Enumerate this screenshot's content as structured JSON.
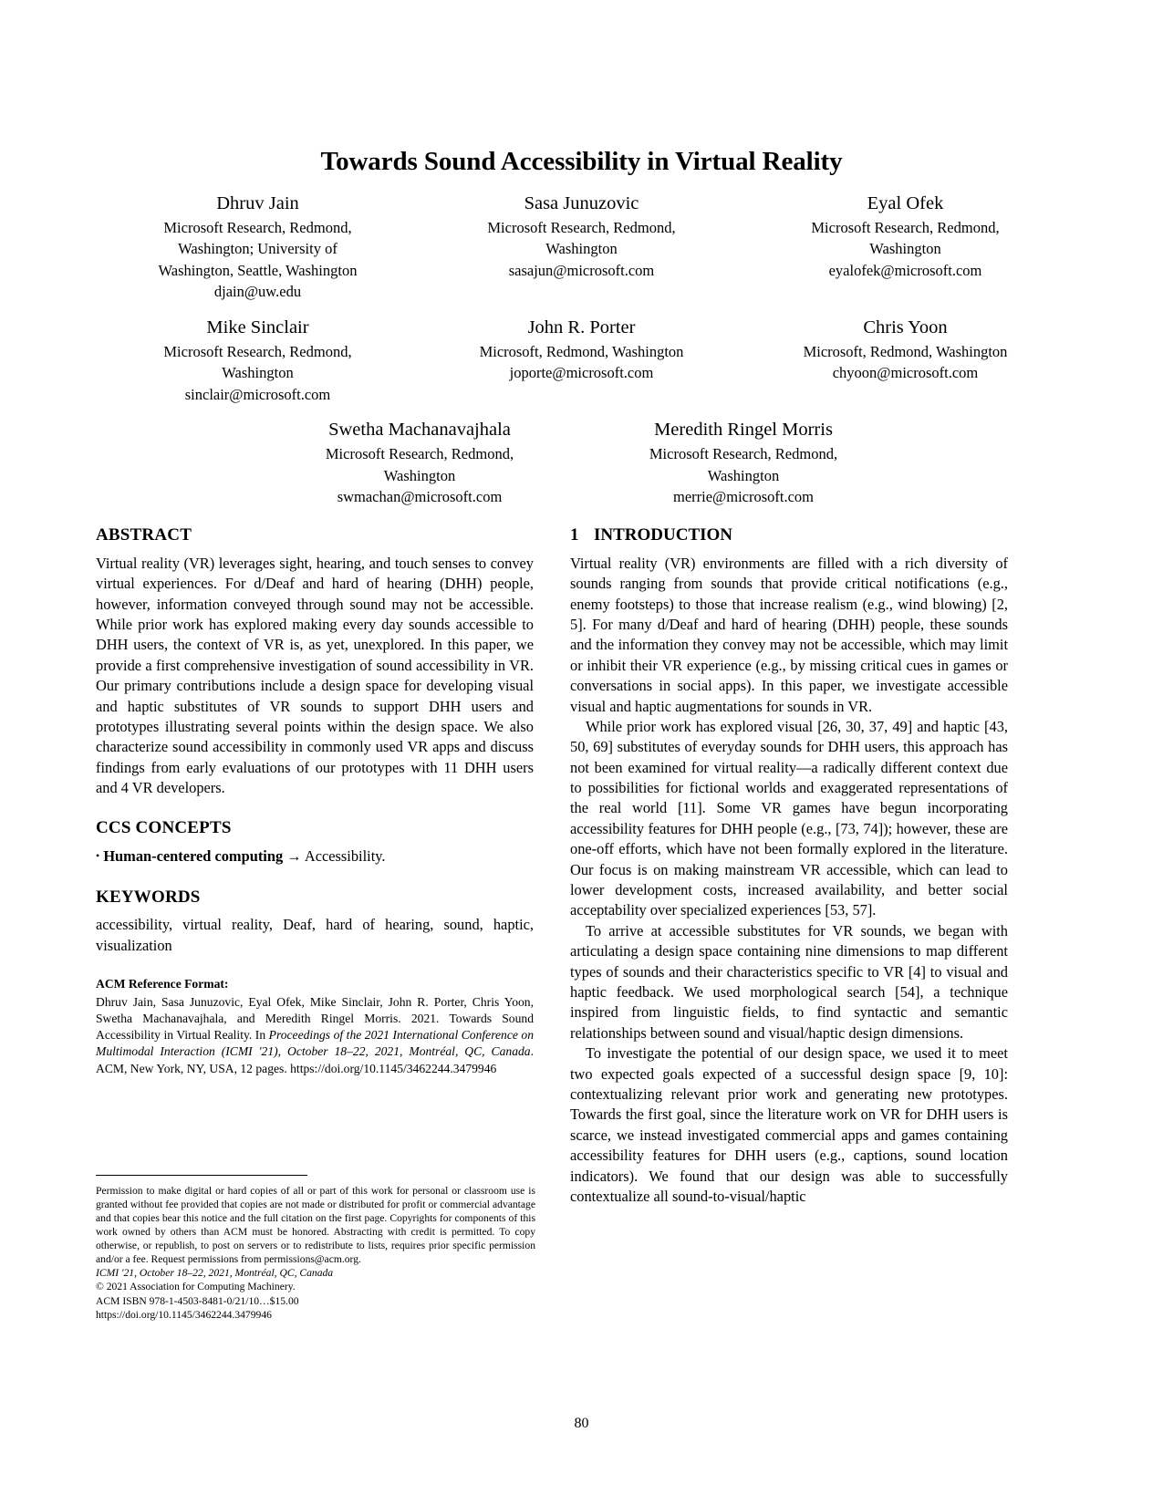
{
  "paper": {
    "title": "Towards Sound Accessibility in Virtual Reality",
    "page_number": "80",
    "authors": [
      {
        "name": "Dhruv Jain",
        "affiliation_lines": [
          "Microsoft Research, Redmond,",
          "Washington; University of",
          "Washington, Seattle, Washington"
        ],
        "email": "djain@uw.edu"
      },
      {
        "name": "Sasa Junuzovic",
        "affiliation_lines": [
          "Microsoft Research, Redmond,",
          "Washington"
        ],
        "email": "sasajun@microsoft.com"
      },
      {
        "name": "Eyal Ofek",
        "affiliation_lines": [
          "Microsoft Research, Redmond,",
          "Washington"
        ],
        "email": "eyalofek@microsoft.com"
      },
      {
        "name": "Mike Sinclair",
        "affiliation_lines": [
          "Microsoft Research, Redmond,",
          "Washington"
        ],
        "email": "sinclair@microsoft.com"
      },
      {
        "name": "John R. Porter",
        "affiliation_lines": [
          "Microsoft, Redmond, Washington"
        ],
        "email": "joporte@microsoft.com"
      },
      {
        "name": "Chris Yoon",
        "affiliation_lines": [
          "Microsoft, Redmond, Washington"
        ],
        "email": "chyoon@microsoft.com"
      },
      {
        "name": "Swetha Machanavajhala",
        "affiliation_lines": [
          "Microsoft Research, Redmond,",
          "Washington"
        ],
        "email": "swmachan@microsoft.com"
      },
      {
        "name": "Meredith Ringel Morris",
        "affiliation_lines": [
          "Microsoft Research, Redmond,",
          "Washington"
        ],
        "email": "merrie@microsoft.com"
      }
    ],
    "abstract": {
      "heading": "ABSTRACT",
      "text": "Virtual reality (VR) leverages sight, hearing, and touch senses to convey virtual experiences. For d/Deaf and hard of hearing (DHH) people, however, information conveyed through sound may not be accessible. While prior work has explored making every day sounds accessible to DHH users, the context of VR is, as yet, unexplored. In this paper, we provide a first comprehensive investigation of sound accessibility in VR. Our primary contributions include a design space for developing visual and haptic substitutes of VR sounds to support DHH users and prototypes illustrating several points within the design space. We also characterize sound accessibility in commonly used VR apps and discuss findings from early evaluations of our prototypes with 11 DHH users and 4 VR developers."
    },
    "ccs": {
      "heading": "CCS CONCEPTS",
      "bullet": "•",
      "bold_part": "Human-centered computing",
      "arrow": "→",
      "rest": "Accessibility."
    },
    "keywords": {
      "heading": "KEYWORDS",
      "text": "accessibility, virtual reality, Deaf, hard of hearing, sound, haptic, visualization"
    },
    "reference_format": {
      "label": "ACM Reference Format:",
      "part1": "Dhruv Jain, Sasa Junuzovic, Eyal Ofek, Mike Sinclair, John R. Porter, Chris Yoon, Swetha Machanavajhala, and Meredith Ringel Morris. 2021. Towards Sound Accessibility in Virtual Reality. In ",
      "italic1": "Proceedings of the 2021 International Conference on Multimodal Interaction (ICMI '21), October 18–22, 2021, Montréal, QC, Canada",
      "part2": ". ACM, New York, NY, USA, 12 pages. ",
      "doi": "https://doi.org/10.1145/3462244.3479946"
    },
    "permission": {
      "paragraph": "Permission to make digital or hard copies of all or part of this work for personal or classroom use is granted without fee provided that copies are not made or distributed for profit or commercial advantage and that copies bear this notice and the full citation on the first page. Copyrights for components of this work owned by others than ACM must be honored. Abstracting with credit is permitted. To copy otherwise, or republish, to post on servers or to redistribute to lists, requires prior specific permission and/or a fee. Request permissions from permissions@acm.org.",
      "conference": "ICMI '21, October 18–22, 2021, Montréal, QC, Canada",
      "copyright": "© 2021 Association for Computing Machinery.",
      "isbn": "ACM ISBN 978-1-4503-8481-0/21/10…$15.00",
      "doi": "https://doi.org/10.1145/3462244.3479946"
    },
    "introduction": {
      "number": "1",
      "heading": "INTRODUCTION",
      "paragraphs": [
        "Virtual reality (VR) environments are filled with a rich diversity of sounds ranging from sounds that provide critical notifications (e.g., enemy footsteps) to those that increase realism (e.g., wind blowing) [2, 5]. For many d/Deaf and hard of hearing (DHH) people, these sounds and the information they convey may not be accessible, which may limit or inhibit their VR experience (e.g., by missing critical cues in games or conversations in social apps). In this paper, we investigate accessible visual and haptic augmentations for sounds in VR.",
        "While prior work has explored visual [26, 30, 37, 49] and haptic [43, 50, 69] substitutes of everyday sounds for DHH users, this approach has not been examined for virtual reality—a radically different context due to possibilities for fictional worlds and exaggerated representations of the real world [11]. Some VR games have begun incorporating accessibility features for DHH people (e.g., [73, 74]); however, these are one-off efforts, which have not been formally explored in the literature. Our focus is on making mainstream VR accessible, which can lead to lower development costs, increased availability, and better social acceptability over specialized experiences [53, 57].",
        "To arrive at accessible substitutes for VR sounds, we began with articulating a design space containing nine dimensions to map different types of sounds and their characteristics specific to VR [4] to visual and haptic feedback. We used morphological search [54], a technique inspired from linguistic fields, to find syntactic and semantic relationships between sound and visual/haptic design dimensions.",
        "To investigate the potential of our design space, we used it to meet two expected goals expected of a successful design space [9, 10]: contextualizing relevant prior work and generating new prototypes. Towards the first goal, since the literature work on VR for DHH users is scarce, we instead investigated commercial apps and games containing accessibility features for DHH users (e.g., captions, sound location indicators). We found that our design was able to successfully contextualize all sound-to-visual/haptic"
      ]
    }
  }
}
